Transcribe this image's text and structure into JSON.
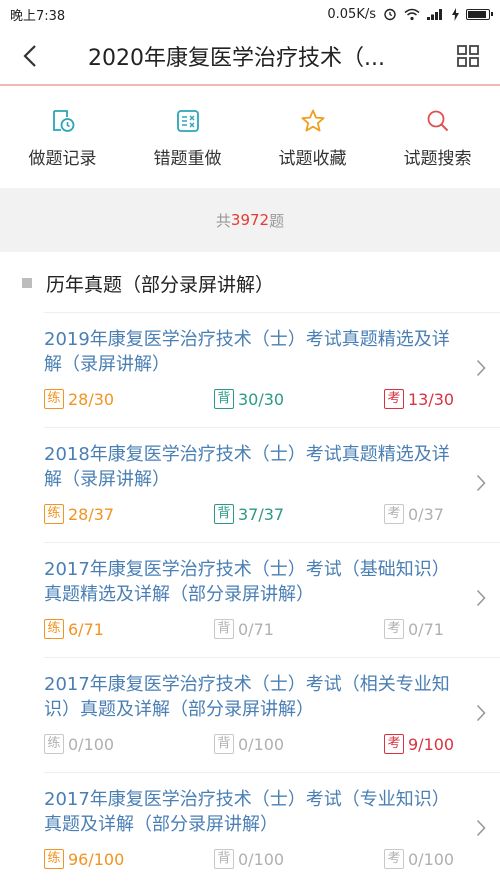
{
  "status_bar": {
    "time": "晚上7:38",
    "speed": "0.05K/s"
  },
  "nav": {
    "title": "2020年康复医学治疗技术（..."
  },
  "toolbar": [
    {
      "label": "做题记录",
      "icon": "clock-record-icon",
      "color": "#2aa6b8"
    },
    {
      "label": "错题重做",
      "icon": "redo-list-icon",
      "color": "#2aa6b8"
    },
    {
      "label": "试题收藏",
      "icon": "star-icon",
      "color": "#f0a020"
    },
    {
      "label": "试题搜索",
      "icon": "search-icon",
      "color": "#e05050"
    }
  ],
  "count": {
    "prefix": "共",
    "number": "3972",
    "suffix": "题"
  },
  "section": {
    "title": "历年真题（部分录屏讲解）"
  },
  "tags": {
    "practice": "练",
    "memorize": "背",
    "exam": "考"
  },
  "items": [
    {
      "title": "2019年康复医学治疗技术（士）考试真题精选及详解（录屏讲解）",
      "practice": "28/30",
      "memorize": "30/30",
      "exam": "13/30",
      "states": [
        "orange",
        "green",
        "red"
      ]
    },
    {
      "title": "2018年康复医学治疗技术（士）考试真题精选及详解（录屏讲解）",
      "practice": "28/37",
      "memorize": "37/37",
      "exam": "0/37",
      "states": [
        "orange",
        "green",
        "grey"
      ]
    },
    {
      "title": "2017年康复医学治疗技术（士）考试（基础知识）真题精选及详解（部分录屏讲解）",
      "practice": "6/71",
      "memorize": "0/71",
      "exam": "0/71",
      "states": [
        "orange",
        "grey",
        "grey"
      ]
    },
    {
      "title": "2017年康复医学治疗技术（士）考试（相关专业知识）真题及详解（部分录屏讲解）",
      "practice": "0/100",
      "memorize": "0/100",
      "exam": "9/100",
      "states": [
        "grey",
        "grey",
        "red"
      ]
    },
    {
      "title": "2017年康复医学治疗技术（士）考试（专业知识）真题及详解（部分录屏讲解）",
      "practice": "96/100",
      "memorize": "0/100",
      "exam": "0/100",
      "states": [
        "orange",
        "grey",
        "grey"
      ]
    }
  ]
}
